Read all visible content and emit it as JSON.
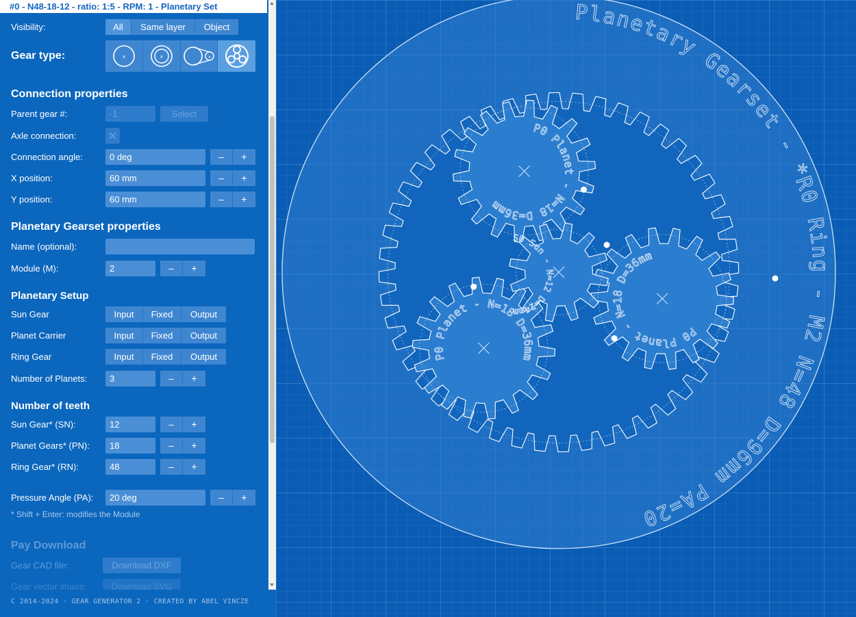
{
  "header": {
    "title": "#0 - N48-18-12 - ratio: 1:5 - RPM: 1 - Planetary Set"
  },
  "visibility": {
    "label": "Visibility:",
    "options": [
      "All",
      "Same layer",
      "Object"
    ],
    "selected": "All"
  },
  "gear_type": {
    "label": "Gear type:",
    "icons": [
      "spur-gear-icon",
      "internal-gear-icon",
      "chain-sprocket-icon",
      "planetary-gearset-icon"
    ],
    "selected": "planetary-gearset-icon"
  },
  "connection": {
    "heading": "Connection properties",
    "parent_label": "Parent gear #:",
    "parent_placeholder": "-1",
    "select_label": "Select",
    "axle_label": "Axle connection:",
    "angle_label": "Connection angle:",
    "angle_value": "0 deg",
    "x_label": "X position:",
    "x_value": "60 mm",
    "y_label": "Y position:",
    "y_value": "60 mm",
    "minus": "–",
    "plus": "+"
  },
  "planetary_props": {
    "heading": "Planetary Gearset properties",
    "name_label": "Name (optional):",
    "name_value": "",
    "module_label": "Module (M):",
    "module_value": "2"
  },
  "setup": {
    "heading": "Planetary Setup",
    "modes": [
      "Input",
      "Fixed",
      "Output"
    ],
    "sun_label": "Sun Gear",
    "carrier_label": "Planet Carrier",
    "ring_label": "Ring Gear",
    "planets_label": "Number of Planets:",
    "planets_value": "3"
  },
  "teeth": {
    "heading": "Number of teeth",
    "sun_label": "Sun Gear* (SN):",
    "sun_value": "12",
    "planet_label": "Planet Gears* (PN):",
    "planet_value": "18",
    "ring_label": "Ring Gear* (RN):",
    "ring_value": "48",
    "pa_label": "Pressure Angle (PA):",
    "pa_value": "20 deg",
    "note": "* Shift + Enter: modifies the Module"
  },
  "download": {
    "heading": "Pay Download",
    "cad_label": "Gear CAD file:",
    "cad_button": "Download DXF",
    "vector_label": "Gear vector image:",
    "vector_button": "Download SVG"
  },
  "footer": {
    "text": "C 2014-2024 - GEAR GENERATOR 2 - CREATED BY ABEL VINCZE"
  },
  "canvas": {
    "ring_text": "Planetary Gearset - *R0 Ring - M2 N=48 D=96mm PA=20",
    "planet_text": "P0 Planet - N=18 D=36mm",
    "sun_text": "S0 Sun - N=12 D=24mm",
    "gears": [
      {
        "kind": "ring",
        "teeth": 48
      },
      {
        "kind": "sun",
        "teeth": 12
      },
      {
        "kind": "planet",
        "teeth": 18
      },
      {
        "kind": "planet",
        "teeth": 18
      },
      {
        "kind": "planet",
        "teeth": 18
      }
    ],
    "colors": {
      "background": "#0a5cb4",
      "panel": "#0b66bd",
      "line": "#ffffff"
    }
  }
}
